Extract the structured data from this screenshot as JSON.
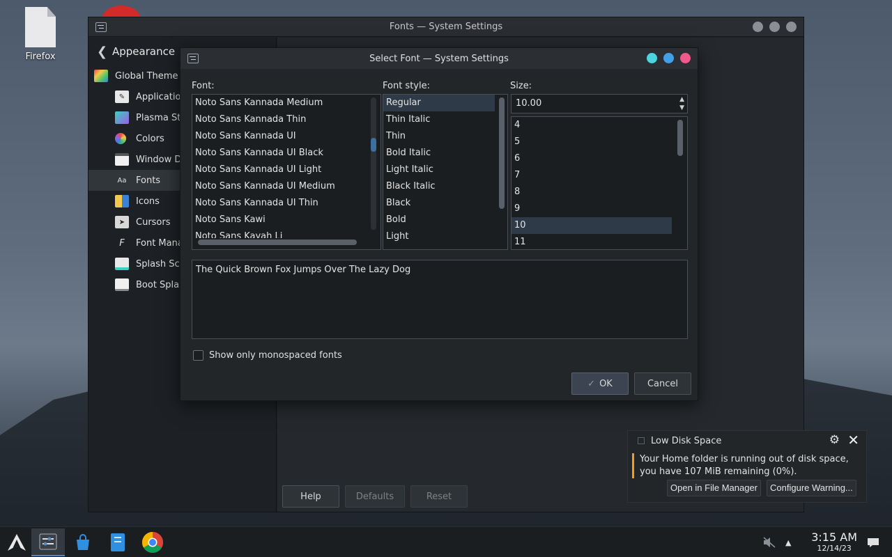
{
  "desktop": {
    "icons": [
      {
        "label": "Firefox"
      }
    ]
  },
  "main_window": {
    "title": "Fonts — System Settings",
    "sidebar": {
      "back_title": "Appearance",
      "items": [
        {
          "label": "Global Theme",
          "icon": "global-theme-icon"
        },
        {
          "label": "Application Style",
          "icon": "application-style-icon"
        },
        {
          "label": "Plasma Style",
          "icon": "plasma-style-icon"
        },
        {
          "label": "Colors",
          "icon": "colors-icon"
        },
        {
          "label": "Window Decorations",
          "icon": "window-decorations-icon"
        },
        {
          "label": "Fonts",
          "icon": "fonts-icon",
          "active": true
        },
        {
          "label": "Icons",
          "icon": "icons-icon"
        },
        {
          "label": "Cursors",
          "icon": "cursors-icon"
        },
        {
          "label": "Font Management",
          "icon": "font-management-icon"
        },
        {
          "label": "Splash Screen",
          "icon": "splash-screen-icon"
        },
        {
          "label": "Boot Splash Screen",
          "icon": "boot-splash-icon"
        }
      ]
    },
    "buttons": {
      "help": "Help",
      "defaults": "Defaults",
      "reset": "Reset"
    }
  },
  "dialog": {
    "title": "Select Font — System Settings",
    "font_label": "Font:",
    "style_label": "Font style:",
    "size_label": "Size:",
    "fonts": [
      "Noto Sans Kannada Medium",
      "Noto Sans Kannada Thin",
      "Noto Sans Kannada UI",
      "Noto Sans Kannada UI Black",
      "Noto Sans Kannada UI Light",
      "Noto Sans Kannada UI Medium",
      "Noto Sans Kannada UI Thin",
      "Noto Sans Kawi",
      "Noto Sans Kayah Li"
    ],
    "styles": [
      "Regular",
      "Thin Italic",
      "Thin",
      "Bold Italic",
      "Light Italic",
      "Black Italic",
      "Black",
      "Bold",
      "Light"
    ],
    "selected_style": "Regular",
    "size_value": "10.00",
    "sizes": [
      "4",
      "5",
      "6",
      "7",
      "8",
      "9",
      "10",
      "11"
    ],
    "selected_size": "10",
    "preview_text": "The Quick Brown Fox Jumps Over The Lazy Dog",
    "monospace_label": "Show only monospaced fonts",
    "monospace_checked": false,
    "ok_label": "OK",
    "cancel_label": "Cancel"
  },
  "notification": {
    "title": "Low Disk Space",
    "body": "Your Home folder is running out of disk space, you have 107 MiB remaining (0%).",
    "action_open": "Open in File Manager",
    "action_configure": "Configure Warning...",
    "accent_color": "#f39c1f"
  },
  "taskbar": {
    "time": "3:15 AM",
    "date": "12/14/23"
  }
}
